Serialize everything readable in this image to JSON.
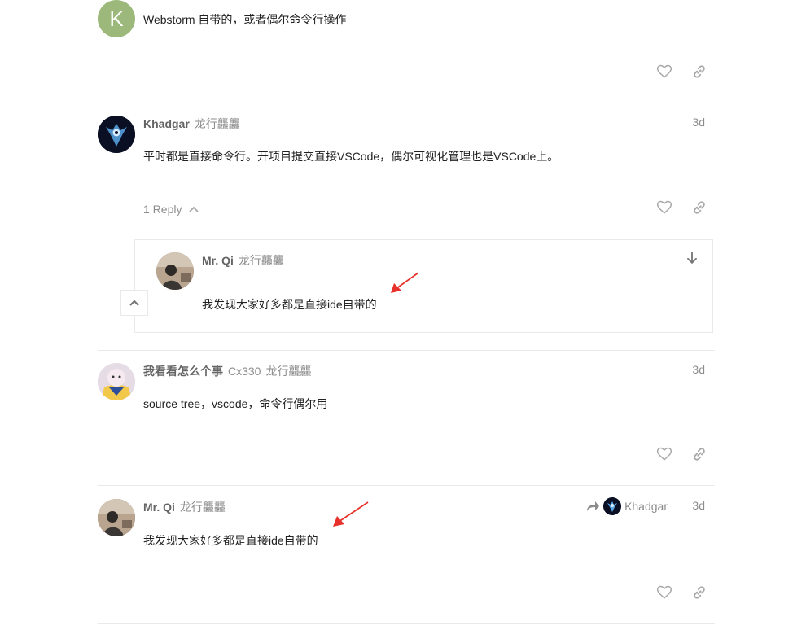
{
  "posts": [
    {
      "avatar_letter": "K",
      "body": "Webstorm 自带的，或者偶尔命令行操作"
    },
    {
      "username": "Khadgar",
      "title": "龙行龘龘",
      "date": "3d",
      "body": "平时都是直接命令行。开项目提交直接VSCode，偶尔可视化管理也是VSCode上。",
      "replies_label": "1 Reply"
    },
    {
      "username": "Mr. Qi",
      "title": "龙行龘龘",
      "body": "我发现大家好多都是直接ide自带的"
    },
    {
      "username": "我看看怎么个事",
      "second_name": "Cx330",
      "title": "龙行龘龘",
      "date": "3d",
      "body": "source tree，vscode，命令行偶尔用"
    },
    {
      "username": "Mr. Qi",
      "title": "龙行龘龘",
      "date": "3d",
      "reply_to": "Khadgar",
      "body": "我发现大家好多都是直接ide自带的"
    }
  ],
  "icons": {
    "like": "heart-icon",
    "share": "link-icon",
    "expand": "chevron-up-icon",
    "jump": "arrow-down-icon",
    "reply_to": "share-arrow-icon"
  },
  "colors": {
    "muted": "#8c8c8c",
    "username": "#646464",
    "annotation": "#e8312a",
    "avatar_letter_bg": "#9cb87a"
  }
}
